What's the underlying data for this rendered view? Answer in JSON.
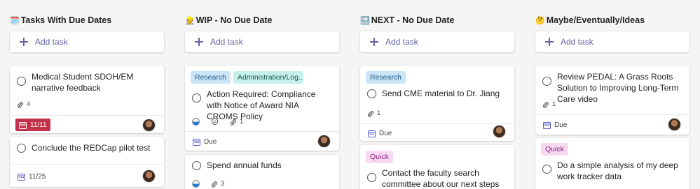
{
  "columns": [
    {
      "emoji": "🗓️",
      "title": "Tasks With Due Dates",
      "add_label": "Add task",
      "cards": [
        {
          "title": "Medical Student SDOH/EM narrative feedback",
          "attachments": "4",
          "due": "11/11",
          "due_overdue": true
        },
        {
          "title": "Conclude the REDCap pilot test",
          "due": "11/25"
        }
      ]
    },
    {
      "emoji": "👷",
      "title": "WIP - No Due Date",
      "add_label": "Add task",
      "cards": [
        {
          "labels": [
            "Research",
            "Administration/Log..."
          ],
          "title": "Action Required: Compliance with Notice of Award NIA CROMS Policy",
          "attachments": "1",
          "due": "Due"
        },
        {
          "title": "Spend annual funds",
          "attachments": "3"
        }
      ]
    },
    {
      "emoji": "🔜",
      "title": "NEXT - No Due Date",
      "add_label": "Add task",
      "cards": [
        {
          "labels": [
            "Research"
          ],
          "title": "Send CME material to Dr. Jiang",
          "attachments": "1",
          "due": "Due"
        },
        {
          "labels": [
            "Quick"
          ],
          "title": "Contact the faculty search committee about our next steps"
        }
      ]
    },
    {
      "emoji": "🤔",
      "title": "Maybe/Eventually/Ideas",
      "add_label": "Add task",
      "cards": [
        {
          "title": "Review PEDAL: A Grass Roots Solution to Improving Long-Term Care video",
          "attachments": "1",
          "due": "Due"
        },
        {
          "labels": [
            "Quick"
          ],
          "title": "Do a simple analysis of my deep work tracker data"
        }
      ]
    }
  ],
  "icons": {
    "add": "plus-icon",
    "complete": "circle-checkbox-icon",
    "attachment": "paperclip-icon",
    "comment": "comment-icon",
    "progress": "half-circle-progress-icon",
    "calendar": "calendar-icon",
    "assignee": "avatar"
  }
}
